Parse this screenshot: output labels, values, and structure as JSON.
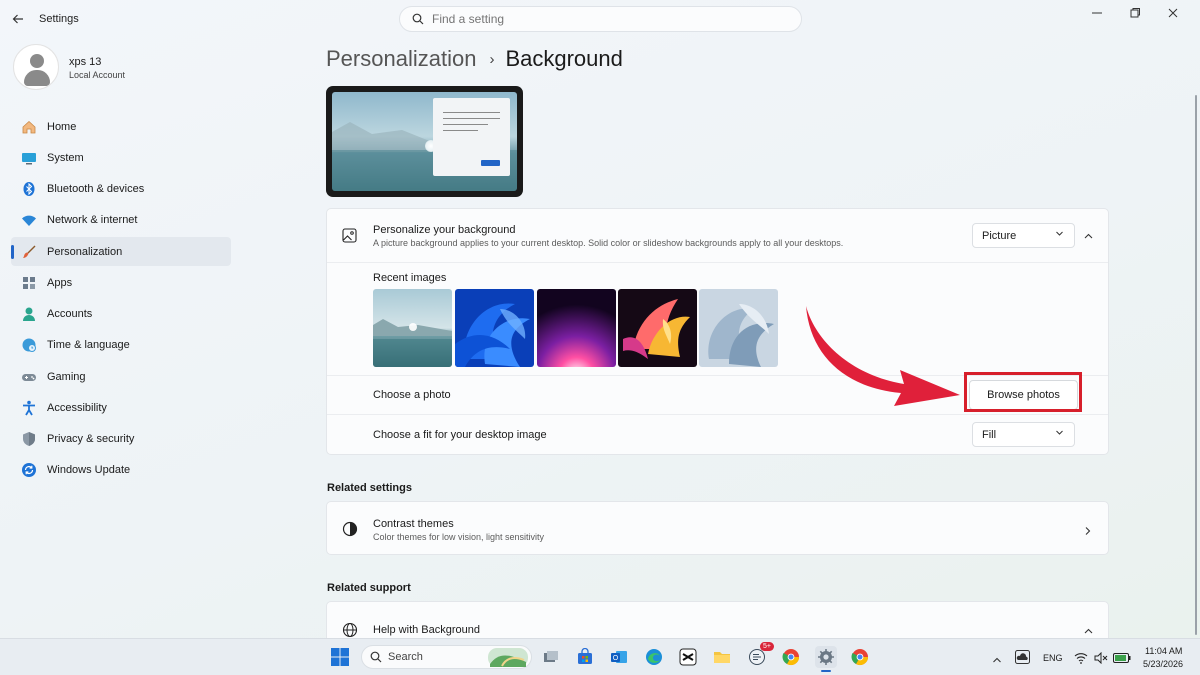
{
  "window": {
    "app_title": "Settings",
    "search": {
      "placeholder": "Find a setting"
    }
  },
  "profile": {
    "name": "xps 13",
    "account_type": "Local Account"
  },
  "sidebar": {
    "items": [
      {
        "label": "Home",
        "icon": "home-icon"
      },
      {
        "label": "System",
        "icon": "monitor-icon"
      },
      {
        "label": "Bluetooth & devices",
        "icon": "bluetooth-icon"
      },
      {
        "label": "Network & internet",
        "icon": "wifi-icon"
      },
      {
        "label": "Personalization",
        "icon": "brush-icon",
        "active": true
      },
      {
        "label": "Apps",
        "icon": "apps-icon"
      },
      {
        "label": "Accounts",
        "icon": "person-icon"
      },
      {
        "label": "Time & language",
        "icon": "globe-clock-icon"
      },
      {
        "label": "Gaming",
        "icon": "gamepad-icon"
      },
      {
        "label": "Accessibility",
        "icon": "accessibility-icon"
      },
      {
        "label": "Privacy & security",
        "icon": "shield-icon"
      },
      {
        "label": "Windows Update",
        "icon": "update-icon"
      }
    ]
  },
  "breadcrumb": {
    "parent": "Personalization",
    "separator": "›",
    "current": "Background"
  },
  "background_card": {
    "title": "Personalize your background",
    "description": "A picture background applies to your current desktop. Solid color or slideshow backgrounds apply to all your desktops.",
    "type_value": "Picture",
    "recent_label": "Recent images",
    "choose_photo_label": "Choose a photo",
    "browse_button": "Browse photos",
    "fit_label": "Choose a fit for your desktop image",
    "fit_value": "Fill"
  },
  "related_settings": {
    "heading": "Related settings",
    "contrast_title": "Contrast themes",
    "contrast_desc": "Color themes for low vision, light sensitivity"
  },
  "related_support": {
    "heading": "Related support",
    "help_title": "Help with Background"
  },
  "taskbar": {
    "search_label": "Search",
    "badge_count": "5+",
    "language": "ENG",
    "time": "11:04 AM",
    "date": "5/23/2026"
  },
  "colors": {
    "accent": "#2265c7",
    "annotation_red": "#d71f2b"
  }
}
